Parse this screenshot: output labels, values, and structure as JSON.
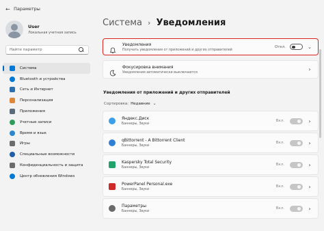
{
  "window": {
    "title": "Параметры",
    "back_glyph": "←"
  },
  "profile": {
    "name": "User",
    "account_type": "Локальная учетная запись"
  },
  "search": {
    "placeholder": "Найти параметр"
  },
  "sidebar": {
    "items": [
      {
        "label": "Система",
        "icon": "system-icon",
        "color": "#0078d4",
        "active": true
      },
      {
        "label": "Bluetooth и устройства",
        "icon": "bluetooth-icon",
        "color": "#0078d4"
      },
      {
        "label": "Сеть и Интернет",
        "icon": "network-icon",
        "color": "#2b6fb0"
      },
      {
        "label": "Персонализация",
        "icon": "personalization-icon",
        "color": "#e0883a"
      },
      {
        "label": "Приложения",
        "icon": "apps-icon",
        "color": "#5a6b7b"
      },
      {
        "label": "Учетные записи",
        "icon": "accounts-icon",
        "color": "#2e9d5b"
      },
      {
        "label": "Время и язык",
        "icon": "time-language-icon",
        "color": "#2a87d0"
      },
      {
        "label": "Игры",
        "icon": "gaming-icon",
        "color": "#6b6b6b"
      },
      {
        "label": "Специальные возможности",
        "icon": "accessibility-icon",
        "color": "#1f5fa8"
      },
      {
        "label": "Конфиденциальность и защита",
        "icon": "privacy-icon",
        "color": "#6b6b6b"
      },
      {
        "label": "Центр обновления Windows",
        "icon": "windows-update-icon",
        "color": "#0078d4"
      }
    ]
  },
  "breadcrumb": {
    "parent": "Система",
    "separator": "›",
    "current": "Уведомления"
  },
  "notifications_card": {
    "title": "Уведомления",
    "subtitle": "Получать уведомления от приложений и других отправителей",
    "state": "Откл.",
    "chevron": "⌄"
  },
  "focus_card": {
    "title": "Фокусировка внимания",
    "subtitle": "Уведомления автоматически выключаются",
    "chevron": "›"
  },
  "apps_section": {
    "title": "Уведомления от приложений и других отправителей",
    "sort_label": "Сортировка:",
    "sort_value": "Недавние",
    "sort_caret": "⌄",
    "apps": [
      {
        "name": "Яндекс.Диск",
        "sub": "Баннеры, Звуки",
        "state": "Вкл.",
        "icon_color": "#3aa0e8"
      },
      {
        "name": "qBittorrent - A Bittorrent Client",
        "sub": "Баннеры, Звуки",
        "state": "Вкл.",
        "icon_color": "#2f7fd6"
      },
      {
        "name": "Kaspersky Total Security",
        "sub": "Баннеры, Звуки",
        "state": "Вкл.",
        "icon_color": "#22a36b"
      },
      {
        "name": "PowerPanel Personal.exe",
        "sub": "Баннеры, Звуки",
        "state": "Вкл.",
        "icon_color": "#cf2a2a"
      },
      {
        "name": "Параметры",
        "sub": "Баннеры, Звуки",
        "state": "Вкл.",
        "icon_color": "#6b6b6b"
      }
    ],
    "chevron": "›"
  }
}
